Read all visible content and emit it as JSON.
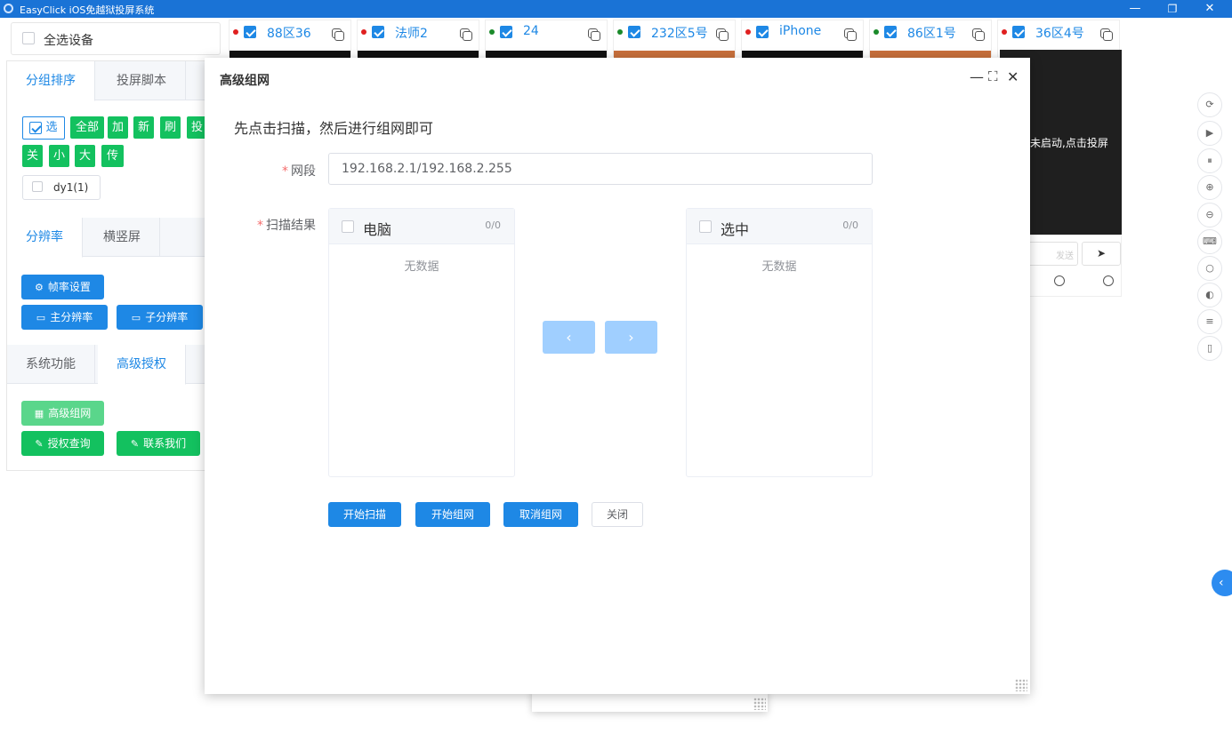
{
  "window": {
    "title": "EasyClick iOS免越狱投屏系统",
    "minimize": "—",
    "restore": "❐",
    "close": "✕"
  },
  "select_all": {
    "label": "全选设备"
  },
  "devices": [
    {
      "name": "88区36",
      "status_color": "#e02020",
      "screen": "dark"
    },
    {
      "name": "法师2",
      "status_color": "#e02020",
      "screen": "dark"
    },
    {
      "name": "24",
      "status_color": "#1a8a2a",
      "screen": "dark"
    },
    {
      "name": "232区5号",
      "status_color": "#1a8a2a",
      "screen": "orange"
    },
    {
      "name": "iPhone",
      "status_color": "#e02020",
      "screen": "dark"
    },
    {
      "name": "86区1号",
      "status_color": "#1a8a2a",
      "screen": "orange"
    },
    {
      "name": "36区4号",
      "status_color": "#e02020",
      "screen": "dark"
    }
  ],
  "big_screen": {
    "text": "未启动,点击投屏"
  },
  "send_bar": {
    "placeholder": "发送",
    "send_icon": "➤"
  },
  "left_panel": {
    "tabs1": [
      "分组排序",
      "投屏脚本"
    ],
    "group_buttons_row1": [
      "选",
      "全部",
      "加",
      "新",
      "刷",
      "投"
    ],
    "group_buttons_row2": [
      "关",
      "小",
      "大",
      "传"
    ],
    "group_item": "dy1(1)",
    "tabs2": [
      "分辨率",
      "横竖屏"
    ],
    "fps_button": "帧率设置",
    "main_res_button": "主分辨率",
    "sub_res_button": "子分辨率",
    "tabs3": [
      "系统功能",
      "高级授权"
    ],
    "adv_network_button": "高级组网",
    "auth_query_button": "授权查询",
    "contact_button": "联系我们"
  },
  "right_toolbar": {
    "icons": [
      "refresh-icon",
      "play-icon",
      "pause-icon",
      "zoom-in-icon",
      "zoom-out-icon",
      "keyboard-icon",
      "search-icon",
      "toggle-icon",
      "sliders-icon",
      "phone-icon"
    ],
    "collapse": "‹"
  },
  "dialog": {
    "title": "高级组网",
    "hint": "先点击扫描，然后进行组网即可",
    "net_segment_label": "网段",
    "net_segment_value": "192.168.2.1/192.168.2.255",
    "scan_result_label": "扫描结果",
    "left_panel_title": "电脑",
    "left_panel_count": "0/0",
    "right_panel_title": "选中",
    "right_panel_count": "0/0",
    "empty_text": "无数据",
    "btn_start_scan": "开始扫描",
    "btn_start_network": "开始组网",
    "btn_cancel_network": "取消组网",
    "btn_close": "关闭",
    "arrow_left": "‹",
    "arrow_right": "›"
  },
  "colors": {
    "titlebar": "#1a73d6",
    "primary": "#1e88e5",
    "green": "#13c15f",
    "arrow_disabled": "#a0cfff"
  }
}
